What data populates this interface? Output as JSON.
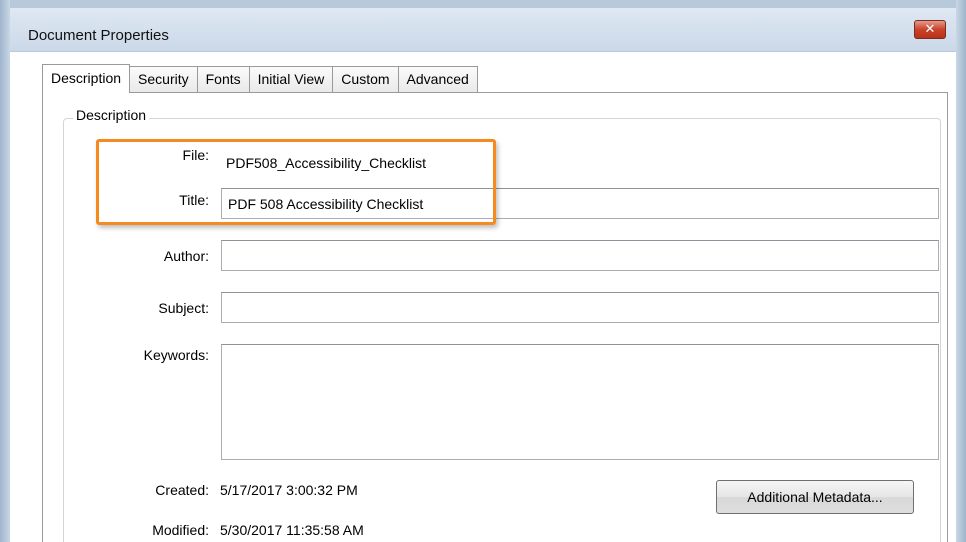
{
  "dialog": {
    "title": "Document Properties",
    "close_glyph": "✕"
  },
  "tabs": [
    {
      "label": "Description",
      "active": true
    },
    {
      "label": "Security",
      "active": false
    },
    {
      "label": "Fonts",
      "active": false
    },
    {
      "label": "Initial View",
      "active": false
    },
    {
      "label": "Custom",
      "active": false
    },
    {
      "label": "Advanced",
      "active": false
    }
  ],
  "description": {
    "group_label": "Description",
    "file_label": "File:",
    "file_value": "PDF508_Accessibility_Checklist",
    "title_label": "Title:",
    "title_value": "PDF 508 Accessibility Checklist",
    "author_label": "Author:",
    "author_value": "",
    "subject_label": "Subject:",
    "subject_value": "",
    "keywords_label": "Keywords:",
    "keywords_value": "",
    "created_label": "Created:",
    "created_value": "5/17/2017 3:00:32 PM",
    "modified_label": "Modified:",
    "modified_value": "5/30/2017 11:35:58 AM",
    "metadata_button": "Additional Metadata..."
  },
  "colors": {
    "highlight": "#f58a1f",
    "close_button": "#c9432a",
    "titlebar": "#dfe8f3"
  }
}
